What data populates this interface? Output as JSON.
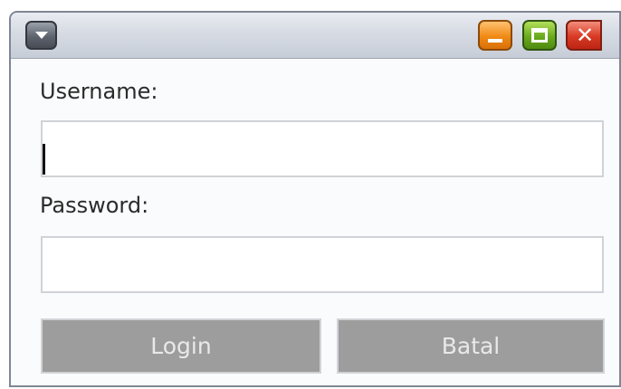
{
  "window": {
    "system_menu_icon": "chevron-down-icon",
    "controls": {
      "minimize_icon": "minimize-icon",
      "maximize_icon": "maximize-icon",
      "close_icon": "close-icon",
      "minimize_color": "#f08a16",
      "maximize_color": "#6aaa1e",
      "close_color": "#d83a24"
    }
  },
  "form": {
    "username_label": "Username:",
    "username_value": "",
    "password_label": "Password:",
    "password_value": ""
  },
  "buttons": {
    "login_label": "Login",
    "cancel_label": "Batal",
    "color": "#9d9d9d"
  }
}
